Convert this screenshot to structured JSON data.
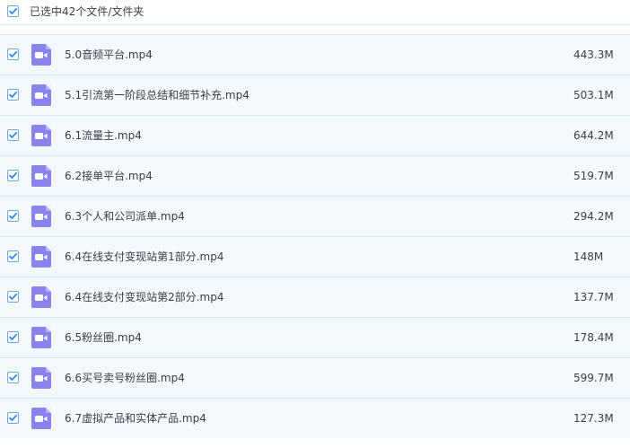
{
  "header": {
    "selection_text": "已选中42个文件/文件夹",
    "checked": true
  },
  "icons": {
    "checkbox": "checkmark-icon",
    "file": "video-file-icon"
  },
  "colors": {
    "checkbox_border": "#6aa7e6",
    "checkmark": "#2f86e8",
    "row_background": "#f3f8fc",
    "video_icon": "#8a83ee",
    "text": "#3a3f47"
  },
  "files": [
    {
      "name": "5.0音频平台.mp4",
      "size": "443.3M",
      "checked": true
    },
    {
      "name": "5.1引流第一阶段总结和细节补充.mp4",
      "size": "503.1M",
      "checked": true
    },
    {
      "name": "6.1流量主.mp4",
      "size": "644.2M",
      "checked": true
    },
    {
      "name": "6.2接单平台.mp4",
      "size": "519.7M",
      "checked": true
    },
    {
      "name": "6.3个人和公司派单.mp4",
      "size": "294.2M",
      "checked": true
    },
    {
      "name": "6.4在线支付变现站第1部分.mp4",
      "size": "148M",
      "checked": true
    },
    {
      "name": "6.4在线支付变现站第2部分.mp4",
      "size": "137.7M",
      "checked": true
    },
    {
      "name": "6.5粉丝圈.mp4",
      "size": "178.4M",
      "checked": true
    },
    {
      "name": "6.6买号卖号粉丝圈.mp4",
      "size": "599.7M",
      "checked": true
    },
    {
      "name": "6.7虚拟产品和实体产品.mp4",
      "size": "127.3M",
      "checked": true
    }
  ]
}
